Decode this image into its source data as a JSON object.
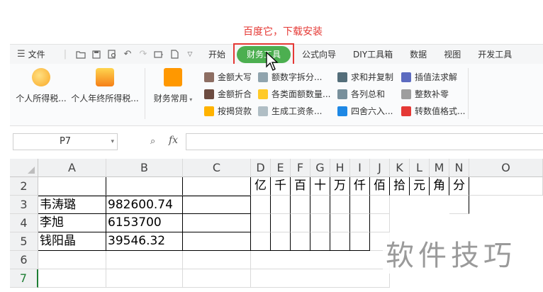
{
  "caption": "百度它，下载安装",
  "tabbar": {
    "menu_label": "文件",
    "tabs": [
      "开始",
      "财务工具",
      "公式向导",
      "DIY工具箱",
      "数据",
      "视图",
      "开发工具"
    ],
    "active_tab": "财务工具"
  },
  "ribbon": {
    "big_buttons": [
      "个人所得税...",
      "个人年终所得税...",
      "财务常用"
    ],
    "group1": [
      "金额大写",
      "金额折合",
      "按揭贷款"
    ],
    "group2": [
      "额数字拆分...",
      "各类面额数量...",
      "生成工资条..."
    ],
    "group3": [
      "求和并复制",
      "各列总和",
      "四舍六入..."
    ],
    "group4": [
      "插值法求解",
      "整数补零",
      "转数值格式..."
    ],
    "colors": {
      "green": "#4caf50",
      "red_border": "#e53935"
    }
  },
  "formula_bar": {
    "name_box": "P7",
    "fx_label": "fx",
    "formula": ""
  },
  "sheet": {
    "columns": [
      "A",
      "B",
      "C",
      "D",
      "E",
      "F",
      "G",
      "H",
      "I",
      "J",
      "K",
      "L",
      "M",
      "N",
      "O"
    ],
    "rows": [
      "2",
      "3",
      "4",
      "5",
      "6",
      "7"
    ],
    "header_units": [
      "亿",
      "千",
      "百",
      "十",
      "万",
      "仟",
      "佰",
      "拾",
      "元",
      "角",
      "分"
    ],
    "data": [
      {
        "name": "韦涛璐",
        "amount": "982600.74"
      },
      {
        "name": "李旭",
        "amount": "6153700"
      },
      {
        "name": "钱阳晶",
        "amount": "39546.32"
      }
    ],
    "selected_row": "7"
  },
  "watermark": "软件技巧"
}
